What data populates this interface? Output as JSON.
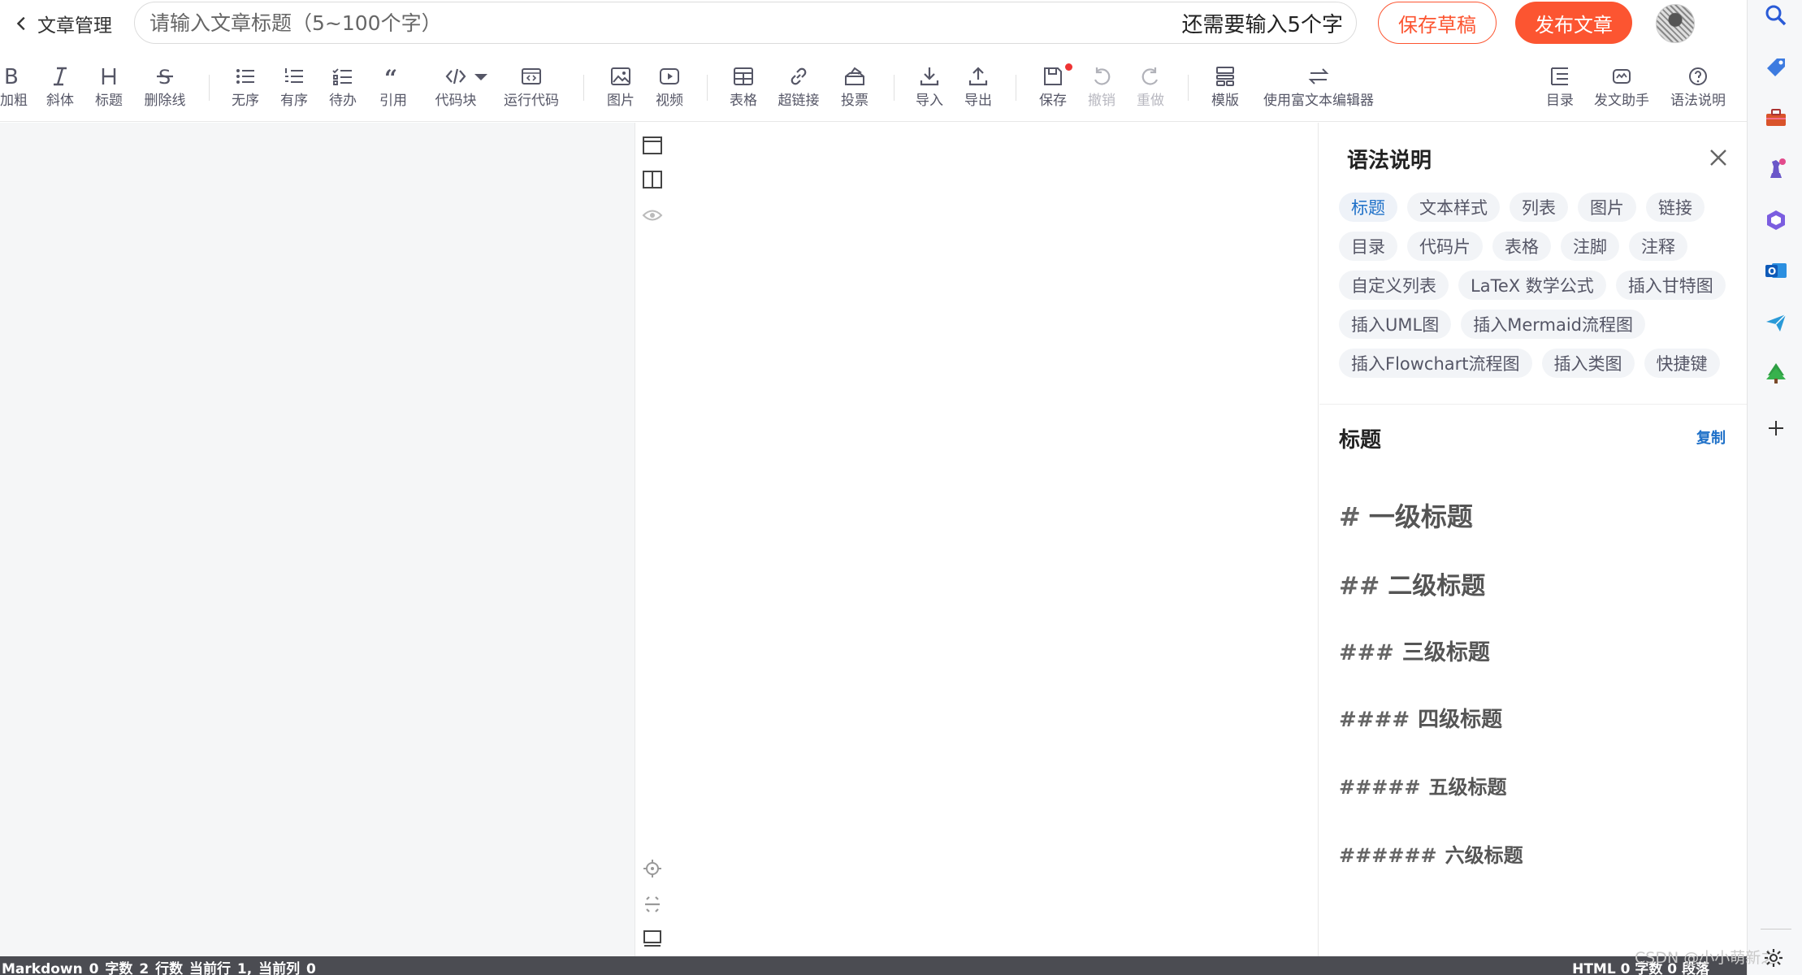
{
  "header": {
    "back_label": "文章管理",
    "title_placeholder": "请输入文章标题（5~100个字）",
    "title_value": "",
    "char_hint": "还需要输入5个字",
    "save_draft_label": "保存草稿",
    "publish_label": "发布文章"
  },
  "toolbar": {
    "bold": "加粗",
    "italic": "斜体",
    "heading": "标题",
    "strike": "删除线",
    "unordered": "无序",
    "ordered": "有序",
    "todo": "待办",
    "quote": "引用",
    "codeblock": "代码块",
    "runcode": "运行代码",
    "image": "图片",
    "video": "视频",
    "table": "表格",
    "link": "超链接",
    "vote": "投票",
    "import": "导入",
    "export": "导出",
    "save": "保存",
    "undo": "撤销",
    "redo": "重做",
    "template": "模版",
    "richtext": "使用富文本编辑器",
    "toc": "目录",
    "assistant": "发文助手",
    "syntax_help": "语法说明"
  },
  "syntax_panel": {
    "title": "语法说明",
    "chips": [
      "标题",
      "文本样式",
      "列表",
      "图片",
      "链接",
      "目录",
      "代码片",
      "表格",
      "注脚",
      "注释",
      "自定义列表",
      "LaTeX 数学公式",
      "插入甘特图",
      "插入UML图",
      "插入Mermaid流程图",
      "插入Flowchart流程图",
      "插入类图",
      "快捷键"
    ],
    "section_title": "标题",
    "copy_label": "复制",
    "examples": [
      {
        "mark": "#",
        "text": "一级标题"
      },
      {
        "mark": "##",
        "text": "二级标题"
      },
      {
        "mark": "###",
        "text": "三级标题"
      },
      {
        "mark": "####",
        "text": "四级标题"
      },
      {
        "mark": "#####",
        "text": "五级标题"
      },
      {
        "mark": "######",
        "text": "六级标题"
      }
    ]
  },
  "status_bar": {
    "left": "Markdown  0 字数  2 行数  当前行 1, 当前列 0",
    "right": "HTML  0 字数  0 段落",
    "watermark": "CSDN @小小萌新之"
  },
  "colors": {
    "accent": "#fc5531",
    "link": "#1e70c8",
    "status_bg": "#4b4c52"
  }
}
